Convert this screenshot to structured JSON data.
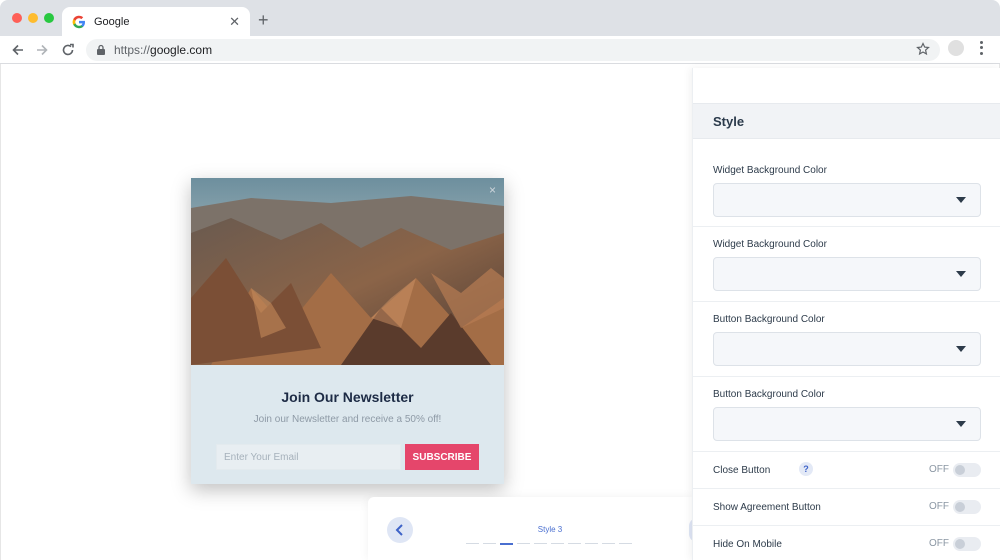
{
  "browser": {
    "tab_title": "Google",
    "url_scheme": "https://",
    "url_host": "google.com"
  },
  "popup": {
    "title": "Join Our Newsletter",
    "subtitle": "Join our Newsletter and receive a 50% off!",
    "email_placeholder": "Enter Your Email",
    "subscribe_label": "SUBSCRIBE",
    "close_symbol": "×",
    "accent_color": "#e5466b"
  },
  "style_selector": {
    "current_label": "Style 3",
    "active_index": 2,
    "total": 10
  },
  "panel": {
    "title": "Style",
    "selects": [
      {
        "label": "Widget Background Color"
      },
      {
        "label": "Widget Background Color"
      },
      {
        "label": "Button Background Color"
      },
      {
        "label": "Button Background Color"
      }
    ],
    "toggles": [
      {
        "label": "Close Button",
        "state": "OFF",
        "help": "?"
      },
      {
        "label": "Show Agreement Button",
        "state": "OFF"
      },
      {
        "label": "Hide On Mobile",
        "state": "OFF"
      }
    ]
  }
}
